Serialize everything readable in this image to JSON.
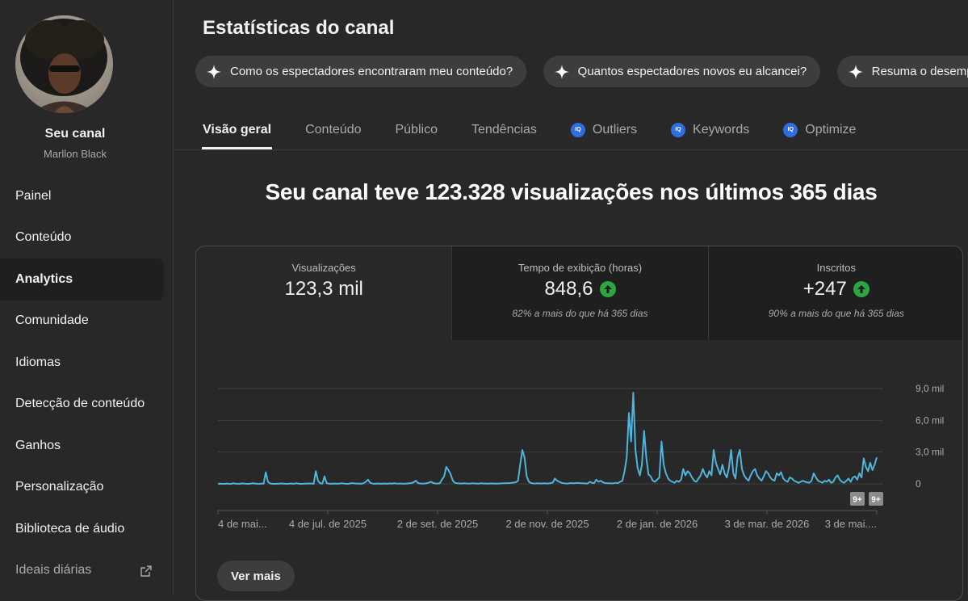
{
  "sidebar": {
    "channel_name": "Seu canal",
    "channel_handle": "Marllon Black",
    "items": [
      {
        "label": "Painel"
      },
      {
        "label": "Conteúdo"
      },
      {
        "label": "Analytics"
      },
      {
        "label": "Comunidade"
      },
      {
        "label": "Idiomas"
      },
      {
        "label": "Detecção de conteúdo"
      },
      {
        "label": "Ganhos"
      },
      {
        "label": "Personalização"
      },
      {
        "label": "Biblioteca de áudio"
      },
      {
        "label": "Ideais diárias"
      }
    ],
    "active_item": "Analytics"
  },
  "header": {
    "title": "Estatísticas do canal"
  },
  "chips": [
    {
      "label": "Como os espectadores encontraram meu conteúdo?",
      "icon": "sparkle-icon"
    },
    {
      "label": "Quantos espectadores novos eu alcancei?",
      "icon": "sparkle-icon"
    },
    {
      "label": "Resuma o desempenho",
      "icon": "sparkle-icon"
    }
  ],
  "tabs": [
    {
      "label": "Visão geral"
    },
    {
      "label": "Conteúdo"
    },
    {
      "label": "Público"
    },
    {
      "label": "Tendências"
    },
    {
      "label": "Outliers",
      "badge": "IQ"
    },
    {
      "label": "Keywords",
      "badge": "IQ"
    },
    {
      "label": "Optimize",
      "badge": "IQ"
    }
  ],
  "headline": "Seu canal teve 123.328 visualizações nos últimos 365 dias",
  "metrics": [
    {
      "label": "Visualizações",
      "value": "123,3 mil",
      "sub": ""
    },
    {
      "label": "Tempo de exibição (horas)",
      "value": "848,6",
      "sub": "82% a mais do que há 365 dias",
      "trend": "up"
    },
    {
      "label": "Inscritos",
      "value": "+247",
      "sub": "90% a mais do que há 365 dias",
      "trend": "up"
    }
  ],
  "colors": {
    "line": "#3ea6ff",
    "line_stroke": "#4fb5dc",
    "up": "#2ba640",
    "iq_badge": "#2f6ee0"
  },
  "chart_data": {
    "type": "line",
    "y_ticks": [
      "9,0 mil",
      "6,0 mil",
      "3,0 mil",
      "0"
    ],
    "ylim": [
      0,
      9000
    ],
    "x_ticks": [
      "4 de mai...",
      "4 de jul. de 2025",
      "2 de set. de 2025",
      "2 de nov. de 2025",
      "2 de jan. de 2026",
      "3 de mar. de 2026",
      "3 de mai...."
    ],
    "grid": true,
    "badges": [
      "9+",
      "9+"
    ],
    "series": [
      {
        "values": [
          0,
          20,
          10,
          0,
          30,
          10,
          0,
          50,
          20,
          10,
          0,
          40,
          30,
          10,
          0,
          20,
          50,
          30,
          10,
          0,
          30,
          20,
          1100,
          200,
          30,
          10,
          0,
          20,
          10,
          40,
          20,
          10,
          0,
          30,
          20,
          10,
          50,
          20,
          0,
          10,
          30,
          20,
          40,
          30,
          10,
          1200,
          300,
          50,
          20,
          700,
          60,
          20,
          10,
          30,
          20,
          10,
          30,
          60,
          20,
          10,
          0,
          50,
          70,
          40,
          20,
          30,
          10,
          60,
          200,
          400,
          100,
          30,
          10,
          20,
          30,
          10,
          20,
          30,
          10,
          40,
          20,
          50,
          30,
          20,
          40,
          10,
          20,
          30,
          50,
          80,
          150,
          300,
          80,
          40,
          20,
          30,
          60,
          120,
          200,
          80,
          40,
          30,
          50,
          400,
          700,
          1600,
          1300,
          900,
          300,
          100,
          60,
          40,
          30,
          50,
          40,
          30,
          20,
          60,
          40,
          30,
          20,
          50,
          30,
          40,
          20,
          30,
          40,
          30,
          20,
          30,
          40,
          50,
          60,
          70,
          80,
          90,
          120,
          150,
          300,
          1800,
          3200,
          2500,
          700,
          200,
          80,
          40,
          30,
          50,
          40,
          30,
          60,
          40,
          30,
          80,
          120,
          500,
          300,
          200,
          100,
          60,
          40,
          30,
          80,
          60,
          50,
          100,
          80,
          60,
          50,
          40,
          30,
          200,
          100,
          80,
          400,
          200,
          300,
          150,
          80,
          60,
          50,
          40,
          60,
          100,
          80,
          200,
          300,
          1200,
          2500,
          6700,
          4000,
          8600,
          3200,
          1500,
          800,
          1800,
          5000,
          2500,
          900,
          700,
          300,
          200,
          400,
          600,
          4000,
          1800,
          1000,
          500,
          300,
          200,
          100,
          300,
          200,
          400,
          1400,
          800,
          1200,
          1000,
          600,
          300,
          200,
          500,
          800,
          1400,
          900,
          600,
          1200,
          800,
          3200,
          2000,
          1400,
          900,
          1800,
          1000,
          600,
          1500,
          3200,
          1000,
          500,
          2500,
          3200,
          1400,
          800,
          500,
          300,
          800,
          1200,
          1400,
          800,
          500,
          300,
          700,
          1200,
          1000,
          600,
          400,
          300,
          1000,
          800,
          1100,
          500,
          300,
          200,
          600,
          500,
          300,
          200,
          100,
          200,
          300,
          200,
          150,
          100,
          300,
          1000,
          600,
          300,
          200,
          100,
          300,
          200,
          400,
          100,
          200,
          600,
          800,
          400,
          200,
          100,
          300,
          500,
          200,
          600,
          700,
          400,
          1000,
          600,
          2400,
          1600,
          1200,
          2000,
          1300,
          1800,
          2500
        ]
      }
    ]
  },
  "buttons": {
    "see_more": "Ver mais"
  }
}
